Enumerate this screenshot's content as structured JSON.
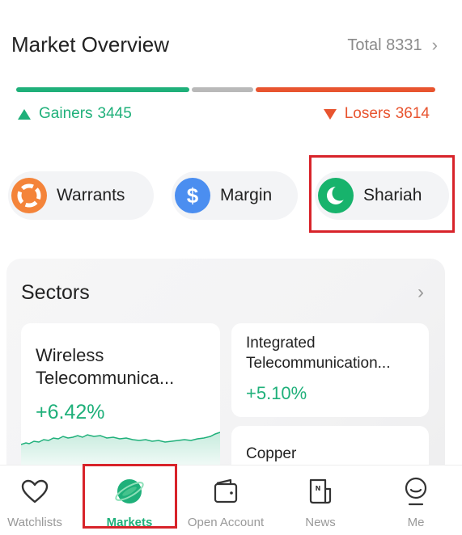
{
  "overview": {
    "title": "Market Overview",
    "total_label": "Total",
    "total_value": "8331",
    "gainers_label": "Gainers",
    "gainers_value": "3445",
    "losers_label": "Losers",
    "losers_value": "3614",
    "colors": {
      "gain": "#1fb07a",
      "loss": "#e8542f",
      "neutral": "#b9b9b9"
    }
  },
  "quick_filters": [
    {
      "label": "Warrants",
      "icon": "warrants-icon",
      "color": "#f4843a"
    },
    {
      "label": "Margin",
      "icon": "dollar-icon",
      "glyph": "$",
      "color": "#4b8ef0"
    },
    {
      "label": "Shariah",
      "icon": "crescent-icon",
      "color": "#17b36c",
      "highlighted": true
    }
  ],
  "sectors": {
    "title": "Sectors",
    "items": [
      {
        "name_line1": "Wireless",
        "name_line2": "Telecommunica...",
        "change": "+6.42%"
      },
      {
        "name_line1": "Integrated",
        "name_line2": "Telecommunication...",
        "change": "+5.10%"
      },
      {
        "name_line1": "Copper",
        "change": ""
      }
    ]
  },
  "nav": {
    "items": [
      {
        "label": "Watchlists",
        "icon": "heart-icon",
        "active": false
      },
      {
        "label": "Markets",
        "icon": "planet-icon",
        "active": true,
        "highlighted": true
      },
      {
        "label": "Open Account",
        "icon": "wallet-icon",
        "active": false
      },
      {
        "label": "News",
        "icon": "news-icon",
        "active": false
      },
      {
        "label": "Me",
        "icon": "profile-icon",
        "active": false
      }
    ]
  },
  "highlight_color": "#d8232a"
}
